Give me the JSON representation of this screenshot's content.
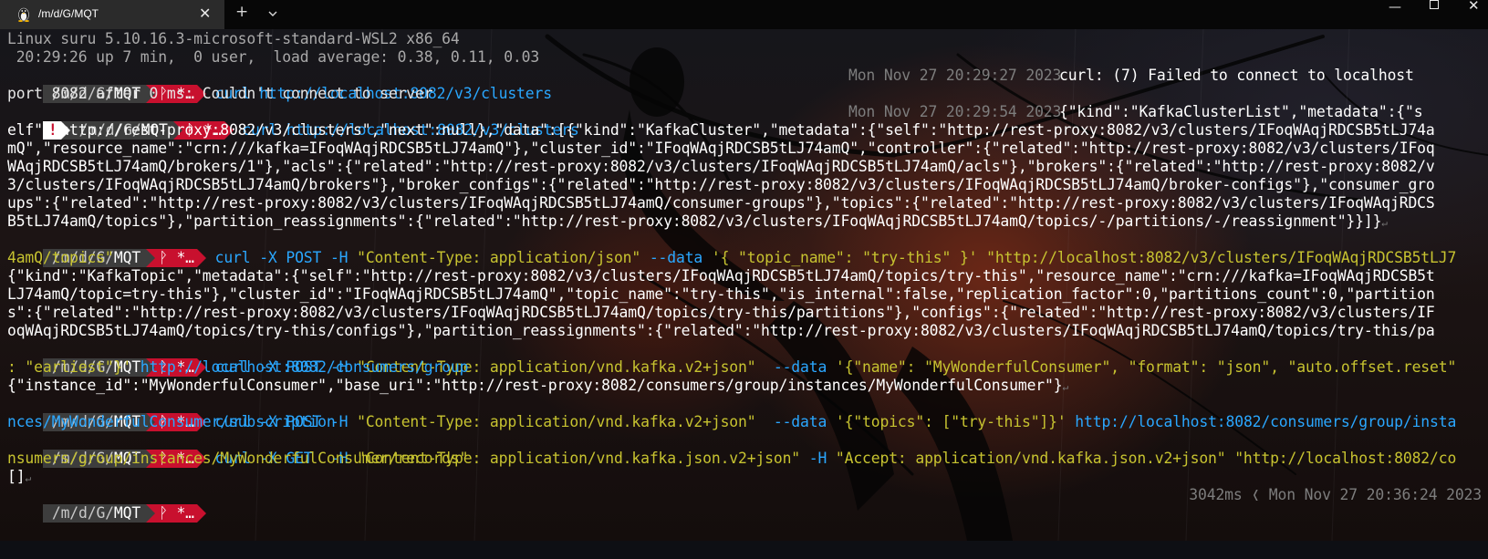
{
  "window": {
    "tab_title": "/m/d/G/MQT",
    "tab_icon": "linux-tux-icon",
    "new_tab_symbol": "+",
    "close_symbol": "✕",
    "min_symbol": "—",
    "win_close_symbol": "✕"
  },
  "colors": {
    "prompt_dir_bg": "#3d3d3d",
    "prompt_git_bg": "#c8102e",
    "command": "#2aa7ff",
    "string": "#c7c330",
    "timestamp": "#7d7d7d"
  },
  "prompt": {
    "dir_prefix": "/m/d/G/",
    "dir_name": "MQT",
    "git_symbol": "ᚹ *…",
    "error_symbol": "!"
  },
  "lines": {
    "l1": "Linux suru 5.10.16.3-microsoft-standard-WSL2 x86_64",
    "l2": " 20:29:26 up 7 min,  0 user,  load average: 0.38, 0.11, 0.03",
    "c1_cmd": "curl ",
    "c1_url": "http://localhost:8082/v3/clusters",
    "c1_time": "Mon Nov 27 20:29:27 2023",
    "c1_out_a": "curl: (7) Failed to connect to localhost",
    "c1_out_b": "port 8082 after 0 ms: Couldn't connect to server",
    "c2_cmd": "curl ",
    "c2_url": "http://localhost:8082/v3/clusters",
    "c2_time": "Mon Nov 27 20:29:54 2023",
    "c2_out_0": "{\"kind\":\"KafkaClusterList\",\"metadata\":{\"s",
    "c2_out_1": "elf\":\"http://rest-proxy:8082/v3/clusters\",\"next\":null},\"data\":[{\"kind\":\"KafkaCluster\",\"metadata\":{\"self\":\"http://rest-proxy:8082/v3/clusters/IFoqWAqjRDCSB5tLJ74a",
    "c2_out_2": "mQ\",\"resource_name\":\"crn:///kafka=IFoqWAqjRDCSB5tLJ74amQ\"},\"cluster_id\":\"IFoqWAqjRDCSB5tLJ74amQ\",\"controller\":{\"related\":\"http://rest-proxy:8082/v3/clusters/IFoq",
    "c2_out_3": "WAqjRDCSB5tLJ74amQ/brokers/1\"},\"acls\":{\"related\":\"http://rest-proxy:8082/v3/clusters/IFoqWAqjRDCSB5tLJ74amQ/acls\"},\"brokers\":{\"related\":\"http://rest-proxy:8082/v",
    "c2_out_4": "3/clusters/IFoqWAqjRDCSB5tLJ74amQ/brokers\"},\"broker_configs\":{\"related\":\"http://rest-proxy:8082/v3/clusters/IFoqWAqjRDCSB5tLJ74amQ/broker-configs\"},\"consumer_gro",
    "c2_out_5": "ups\":{\"related\":\"http://rest-proxy:8082/v3/clusters/IFoqWAqjRDCSB5tLJ74amQ/consumer-groups\"},\"topics\":{\"related\":\"http://rest-proxy:8082/v3/clusters/IFoqWAqjRDCS",
    "c2_out_6": "B5tLJ74amQ/topics\"},\"partition_reassignments\":{\"related\":\"http://rest-proxy:8082/v3/clusters/IFoqWAqjRDCSB5tLJ74amQ/topics/-/partitions/-/reassignment\"}}]}",
    "c3_cmd": "curl -X POST -H ",
    "c3_str1": "\"Content-Type: application/json\"",
    "c3_flag": " --data ",
    "c3_str2": "'{ \"topic_name\": \"try-this\" }'",
    "c3_str3": " \"http://localhost:8082/v3/clusters/IFoqWAqjRDCSB5tLJ7",
    "c3_str4": "4amQ/topics\"",
    "c3_out_0": "{\"kind\":\"KafkaTopic\",\"metadata\":{\"self\":\"http://rest-proxy:8082/v3/clusters/IFoqWAqjRDCSB5tLJ74amQ/topics/try-this\",\"resource_name\":\"crn:///kafka=IFoqWAqjRDCSB5t",
    "c3_out_1": "LJ74amQ/topic=try-this\"},\"cluster_id\":\"IFoqWAqjRDCSB5tLJ74amQ\",\"topic_name\":\"try-this\",\"is_internal\":false,\"replication_factor\":0,\"partitions_count\":0,\"partition",
    "c3_out_2": "s\":{\"related\":\"http://rest-proxy:8082/v3/clusters/IFoqWAqjRDCSB5tLJ74amQ/topics/try-this/partitions\"},\"configs\":{\"related\":\"http://rest-proxy:8082/v3/clusters/IF",
    "c3_out_3": "oqWAqjRDCSB5tLJ74amQ/topics/try-this/configs\"},\"partition_reassignments\":{\"related\":\"http://rest-proxy:8082/v3/clusters/IFoqWAqjRDCSB5tLJ74amQ/topics/try-this/pa",
    "c4_cmd": "curl -X POST -H ",
    "c4_str1": "\"Content-Type: application/vnd.kafka.v2+json\"",
    "c4_flag": "  --data ",
    "c4_str2": "'{\"name\": \"MyWonderfulConsumer\", \"format\": \"json\", \"auto.offset.reset\"",
    "c4_str3": ": \"earliest\"}'",
    "c4_url": " http://localhost:8082/consumers/group",
    "c4_out": "{\"instance_id\":\"MyWonderfulConsumer\",\"base_uri\":\"http://rest-proxy:8082/consumers/group/instances/MyWonderfulConsumer\"}",
    "c5_cmd": "curl -X POST -H ",
    "c5_str1": "\"Content-Type: application/vnd.kafka.v2+json\"",
    "c5_flag": "  --data ",
    "c5_str2": "'{\"topics\": [\"try-this\"]}'",
    "c5_url": " http://localhost:8082/consumers/group/insta",
    "c5_url2": "nces/MyWonderfulConsumer/subscription",
    "c6_cmd": "curl -X GET  -H ",
    "c6_str1": "\"Content-Type: application/vnd.kafka.json.v2+json\"",
    "c6_flag": " -H ",
    "c6_str2": "\"Accept: application/vnd.kafka.json.v2+json\"",
    "c6_str3": " \"http://localhost:8082/co",
    "c6_str4": "nsumers/group/instances/MyWonderfulConsumer/records\"",
    "c6_out": "[]",
    "last_duration": "3042ms",
    "last_time": "Mon Nov 27 20:36:24 2023"
  }
}
